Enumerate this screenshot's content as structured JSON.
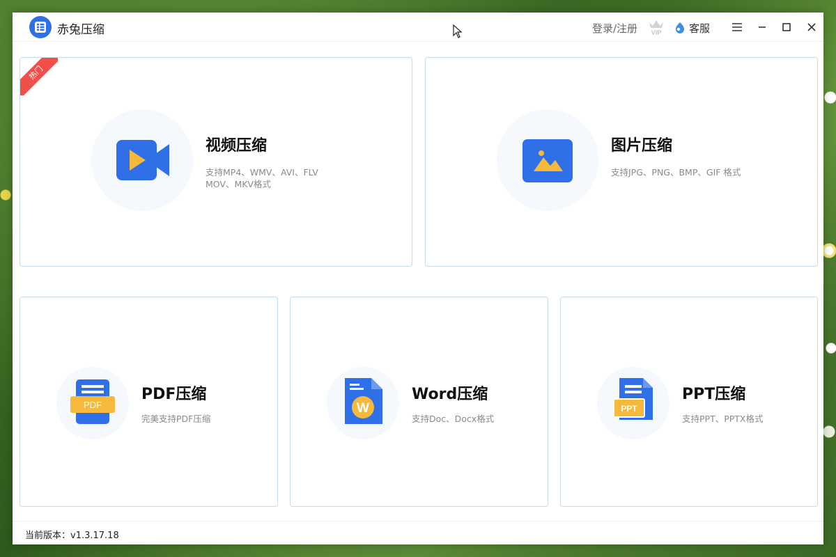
{
  "app": {
    "title": "赤兔压缩",
    "login_label": "登录/注册",
    "vip_label": "VIP",
    "support_label": "客服",
    "version_label": "当前版本：v1.3.17.18"
  },
  "cards": [
    {
      "title": "视频压缩",
      "desc": "支持MP4、WMV、AVI、FLV MOV、MKV格式",
      "badge": "热门",
      "icon": "video-icon"
    },
    {
      "title": "图片压缩",
      "desc": "支持JPG、PNG、BMP、GIF 格式",
      "icon": "image-icon"
    },
    {
      "title": "PDF压缩",
      "desc": "完美支持PDF压缩",
      "icon": "pdf-icon",
      "icon_text": "PDF"
    },
    {
      "title": "Word压缩",
      "desc": "支持Doc、Docx格式",
      "icon": "word-icon",
      "icon_text": "W"
    },
    {
      "title": "PPT压缩",
      "desc": "支持PPT、PPTX格式",
      "icon": "ppt-icon",
      "icon_text": "PPT"
    }
  ],
  "colors": {
    "primary": "#2f6fe8",
    "accent": "#f6b93b",
    "badge": "#f0504a"
  }
}
